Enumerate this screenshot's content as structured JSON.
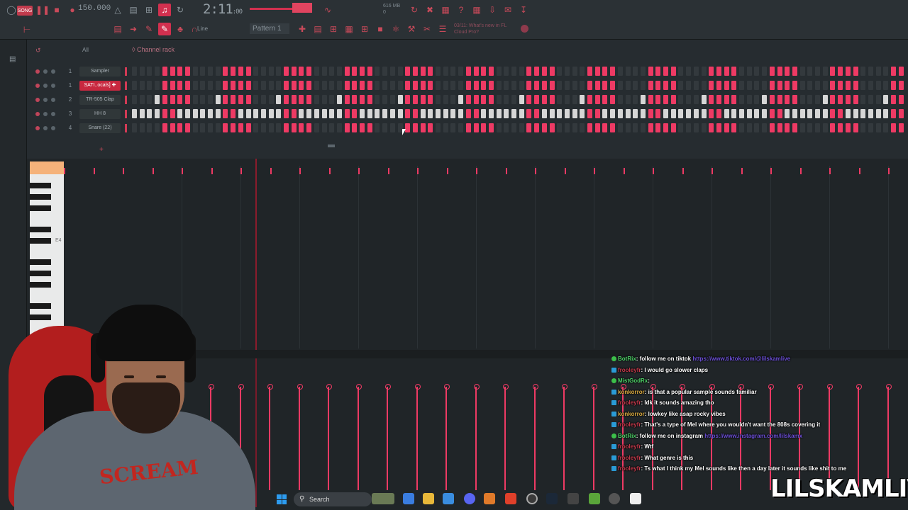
{
  "toolbar": {
    "tempo": "150.000",
    "time": "2:11",
    "time_sub": ":00",
    "cpu_line1": "616 MB",
    "cpu_line2": "0",
    "pattern": "Pattern 1",
    "snap": "Line",
    "news_line1": "03/11: What's new in FL",
    "news_line2": "Cloud Pro?",
    "accent_color": "#ee3a64"
  },
  "channel_rack": {
    "filter": "All",
    "title": "Channel rack",
    "channels": [
      {
        "num": "1",
        "name": "Sampler",
        "selected": false,
        "pattern": "offsetA"
      },
      {
        "num": "1",
        "name": "SATI..ocals] ✚",
        "selected": true,
        "pattern": "offsetA"
      },
      {
        "num": "2",
        "name": "TR-505 Clap",
        "selected": false,
        "pattern": "offsetB"
      },
      {
        "num": "3",
        "name": "HH 8",
        "selected": false,
        "pattern": "white"
      },
      {
        "num": "4",
        "name": "Snare (22)",
        "selected": false,
        "pattern": "offsetA"
      }
    ]
  },
  "piano_roll": {
    "note_label": "E4"
  },
  "chat": [
    {
      "user": "BotRix",
      "user_style": "g",
      "text": ": follow me on tiktok ",
      "link": "https://www.tiktok.com/@lilskamlive",
      "badge": "g"
    },
    {
      "user": "frooleyfr",
      "user_style": "r",
      "text": ": I would go slower claps",
      "link": "",
      "badge": "b"
    },
    {
      "user": "MistGodRx",
      "user_style": "g",
      "text": ":",
      "link": "",
      "badge": "g"
    },
    {
      "user": "konkorror",
      "user_style": "o",
      "text": ": is that a popular sample sounds familiar",
      "link": "",
      "badge": "b"
    },
    {
      "user": "frooleyfr",
      "user_style": "r",
      "text": ": Idk it sounds amazing tho",
      "link": "",
      "badge": "b"
    },
    {
      "user": "konkorror",
      "user_style": "o",
      "text": ": lowkey like asap rocky vibes",
      "link": "",
      "badge": "b"
    },
    {
      "user": "frooleyfr",
      "user_style": "r",
      "text": ": That's a type of Mel where you wouldn't want the 808s covering it",
      "link": "",
      "badge": "b"
    },
    {
      "user": "BotRix",
      "user_style": "g",
      "text": ": follow me on instagram ",
      "link": "https://www.instagram.com/lilskamx",
      "badge": "g"
    },
    {
      "user": "frooleyfr",
      "user_style": "r",
      "text": ": Wtf",
      "link": "",
      "badge": "b"
    },
    {
      "user": "frooleyfr",
      "user_style": "r",
      "text": ": What genre is this",
      "link": "",
      "badge": "b"
    },
    {
      "user": "frooleyfr",
      "user_style": "r",
      "text": ": Ts what I think my Mel sounds like then a day later it sounds like shit to me",
      "link": "",
      "badge": "b"
    }
  ],
  "webcam": {
    "hoodie_text": "SCREAM"
  },
  "taskbar": {
    "search_placeholder": "Search"
  },
  "watermark": "LILSKAMLIVE"
}
